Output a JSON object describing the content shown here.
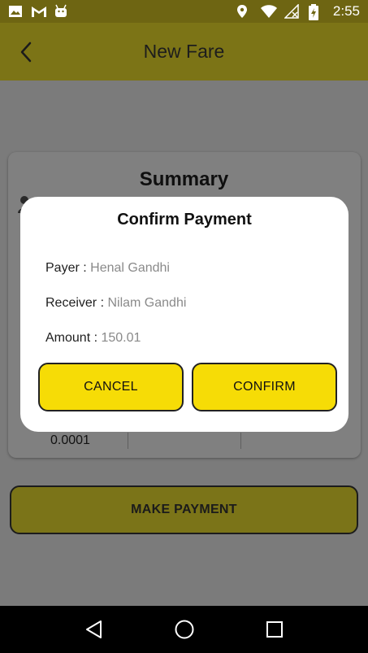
{
  "status_bar": {
    "time": "2:55",
    "left_icons": [
      "image-icon",
      "gmail-icon",
      "android-icon"
    ],
    "right_icons": [
      "location-icon",
      "wifi-icon",
      "signal-icon",
      "battery-icon"
    ]
  },
  "app_bar": {
    "title": "New Fare",
    "back_icon": "back-arrow-icon"
  },
  "summary": {
    "title": "Summary",
    "value": "0.0001"
  },
  "make_payment_label": "MAKE PAYMENT",
  "dialog": {
    "title": "Confirm Payment",
    "payer_label": "Payer : ",
    "payer_value": "Henal Gandhi",
    "receiver_label": "Receiver : ",
    "receiver_value": "Nilam Gandhi",
    "amount_label": "Amount : ",
    "amount_value": "150.01",
    "cancel_label": "CANCEL",
    "confirm_label": "CONFIRM"
  },
  "colors": {
    "accent": "#f6dc06",
    "dialog_bg": "#ffffff",
    "scrim": "#7b7b7b"
  },
  "nav_bar": {
    "icons": [
      "back-triangle-icon",
      "home-circle-icon",
      "recents-square-icon"
    ]
  }
}
